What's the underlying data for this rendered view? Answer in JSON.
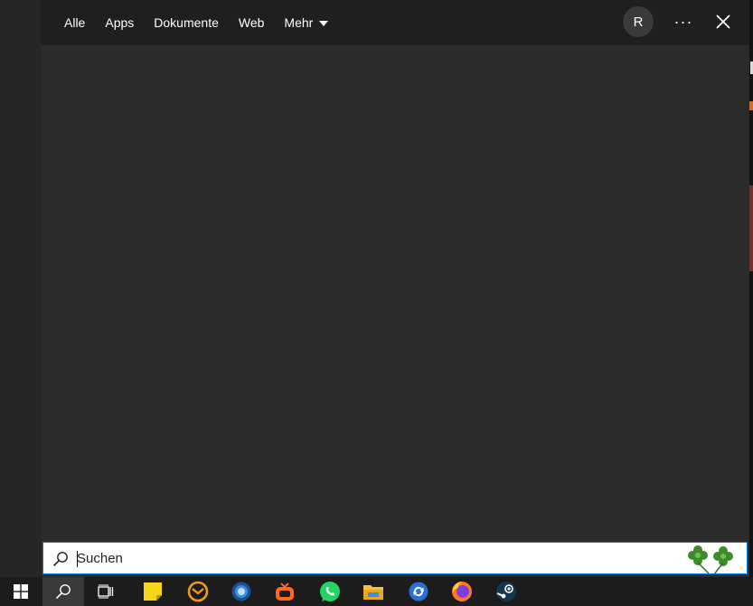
{
  "topbar": {
    "tabs": [
      {
        "label": "Alle"
      },
      {
        "label": "Apps"
      },
      {
        "label": "Dokumente"
      },
      {
        "label": "Web"
      },
      {
        "label": "Mehr",
        "has_dropdown": true
      }
    ],
    "avatar_initial": "R",
    "more_label": "···"
  },
  "search": {
    "placeholder": "Suchen",
    "value": "",
    "icon": "search-icon",
    "decoration": "clover-icon"
  },
  "taskbar": {
    "items": [
      {
        "name": "start-button",
        "icon": "windows-logo-icon"
      },
      {
        "name": "search-button",
        "icon": "search-icon",
        "active": true
      },
      {
        "name": "task-view-button",
        "icon": "task-view-icon"
      },
      {
        "name": "sticky-notes-app",
        "icon": "sticky-notes-icon"
      },
      {
        "name": "em-client-app",
        "icon": "email-client-icon"
      },
      {
        "name": "circular-app",
        "icon": "circle-app-icon"
      },
      {
        "name": "tv-app",
        "icon": "tv-icon"
      },
      {
        "name": "whatsapp-app",
        "icon": "whatsapp-icon"
      },
      {
        "name": "file-explorer-app",
        "icon": "folder-icon"
      },
      {
        "name": "sync-app",
        "icon": "sync-icon"
      },
      {
        "name": "firefox-app",
        "icon": "firefox-icon"
      },
      {
        "name": "steam-app",
        "icon": "steam-icon"
      }
    ]
  },
  "colors": {
    "panel": "#2b2b2b",
    "topbar": "#1f1f1f",
    "accent": "#0078d7"
  }
}
